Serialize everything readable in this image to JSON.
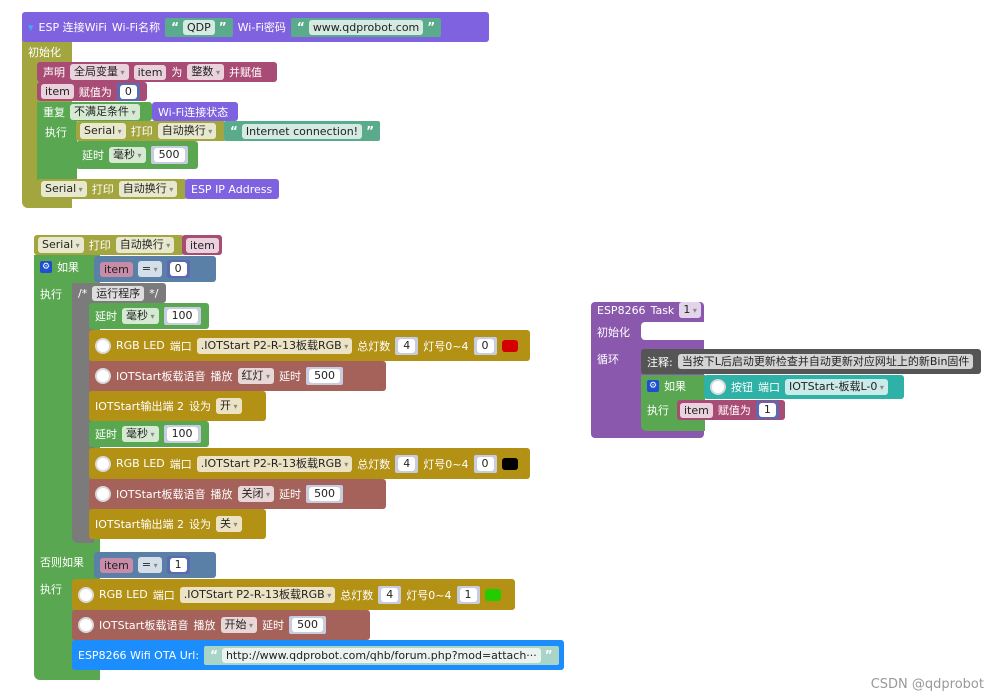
{
  "wifi": {
    "title": "ESP 连接WiFi",
    "ssid_label": "Wi-Fi名称",
    "ssid": "QDP",
    "pwd_label": "Wi-Fi密码",
    "pwd": "www.qdprobot.com"
  },
  "setup": {
    "label": "初始化",
    "declare": {
      "kw": "声明",
      "scope": "全局变量",
      "var": "item",
      "as": "为",
      "type": "整数",
      "assign": "并赋值"
    },
    "assign0": {
      "var": "item",
      "kw": "赋值为",
      "value": "0"
    },
    "repeat": {
      "kw": "重复",
      "mode": "不满足条件",
      "cond": "Wi-Fi连接状态",
      "do": "执行"
    },
    "print1": {
      "port": "Serial",
      "kw": "打印",
      "mode": "自动换行",
      "text": "Internet connection!"
    },
    "delay1": {
      "kw": "延时",
      "unit": "毫秒",
      "value": "500"
    },
    "print2": {
      "port": "Serial",
      "kw": "打印",
      "mode": "自动换行",
      "text": "ESP IP Address"
    }
  },
  "loop": {
    "print": {
      "port": "Serial",
      "kw": "打印",
      "mode": "自动换行",
      "var": "item"
    },
    "if": {
      "kw": "如果",
      "var": "item",
      "op": "=",
      "value": "0",
      "do": "执行"
    },
    "comment": {
      "open": "/*",
      "text": "运行程序",
      "close": "*/"
    },
    "delayA": {
      "kw": "延时",
      "unit": "毫秒",
      "value": "100"
    },
    "rgbA": {
      "label": "RGB LED",
      "port_kw": "端口",
      "port": ".IOTStart P2-R-13板载RGB",
      "count_kw": "总灯数",
      "count": "4",
      "idx_kw": "灯号0~4",
      "idx": "0",
      "color": "#d40000"
    },
    "voiceA": {
      "label": "IOTStart板载语音",
      "kw": "播放",
      "sound": "红灯",
      "delay_kw": "延时",
      "delay": "500"
    },
    "outA": {
      "label": "IOTStart输出端 2",
      "kw": "设为",
      "value": "开"
    },
    "delayB": {
      "kw": "延时",
      "unit": "毫秒",
      "value": "100"
    },
    "rgbB": {
      "label": "RGB LED",
      "port_kw": "端口",
      "port": ".IOTStart P2-R-13板载RGB",
      "count_kw": "总灯数",
      "count": "4",
      "idx_kw": "灯号0~4",
      "idx": "0",
      "color": "#000000"
    },
    "voiceB": {
      "label": "IOTStart板载语音",
      "kw": "播放",
      "sound": "关闭",
      "delay_kw": "延时",
      "delay": "500"
    },
    "outB": {
      "label": "IOTStart输出端 2",
      "kw": "设为",
      "value": "关"
    },
    "elif": {
      "kw": "否则如果",
      "var": "item",
      "op": "=",
      "value": "1",
      "do": "执行"
    },
    "rgbC": {
      "label": "RGB LED",
      "port_kw": "端口",
      "port": ".IOTStart P2-R-13板载RGB",
      "count_kw": "总灯数",
      "count": "4",
      "idx_kw": "灯号0~4",
      "idx": "1",
      "color": "#22cc00"
    },
    "voiceC": {
      "label": "IOTStart板载语音",
      "kw": "播放",
      "sound": "开始",
      "delay_kw": "延时",
      "delay": "500"
    },
    "ota": {
      "label": "ESP8266 Wifi OTA Url:",
      "url": "http://www.qdprobot.com/qhb/forum.php?mod=attach···"
    }
  },
  "task": {
    "title": "ESP8266",
    "task_kw": "Task",
    "task_no": "1",
    "setup": "初始化",
    "loop": "循环",
    "note": {
      "kw": "注释:",
      "text": "当按下L后启动更新检查并自动更新对应网址上的新Bin固件"
    },
    "if": {
      "kw": "如果",
      "btn": "按钮",
      "port_kw": "端口",
      "port": "IOTStart-板载L-0",
      "do": "执行"
    },
    "assign": {
      "var": "item",
      "kw": "赋值为",
      "value": "1"
    }
  },
  "watermark": "CSDN @qdprobot"
}
